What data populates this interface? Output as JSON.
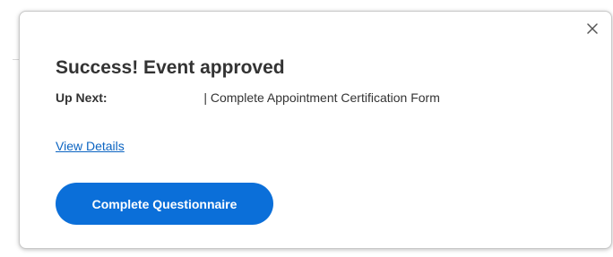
{
  "dialog": {
    "title": "Success! Event approved",
    "up_next_label": "Up Next:",
    "up_next_text": "| Complete Appointment Certification Form",
    "view_details_link": "View Details",
    "primary_button": "Complete Questionnaire",
    "close_icon": "close-icon"
  },
  "colors": {
    "accent": "#0b6fd9",
    "link": "#0b64c2",
    "title_text": "#333333"
  }
}
